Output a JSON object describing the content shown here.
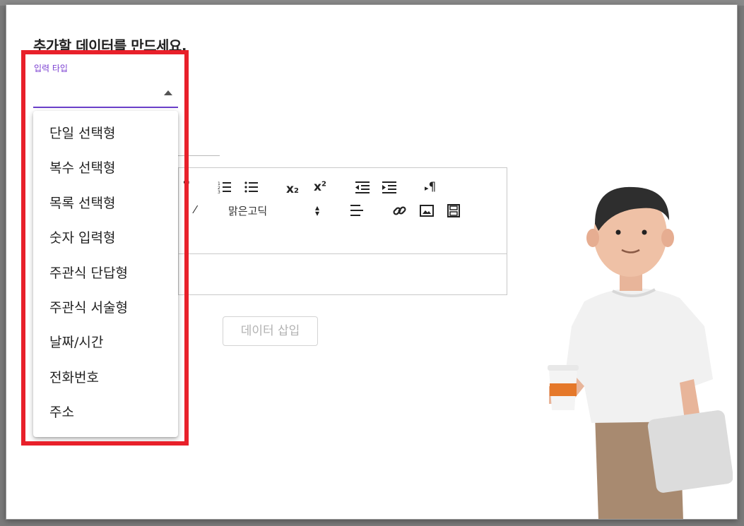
{
  "dialog": {
    "title": "추가할 데이터를 만드세요."
  },
  "input_type": {
    "label": "입력 타입",
    "options": [
      "단일 선택형",
      "복수 선택형",
      "목록 선택형",
      "숫자 입력형",
      "주관식 단답형",
      "주관식 서술형",
      "날짜/시간",
      "전화번호",
      "주소"
    ]
  },
  "editor": {
    "font_name": "맑은고딕",
    "toolbar_icons": [
      "quote-icon",
      "ordered-list-icon",
      "unordered-list-icon",
      "subscript-icon",
      "superscript-icon",
      "outdent-icon",
      "indent-icon",
      "paragraph-direction-icon",
      "clear-format-icon",
      "font-select",
      "align-icon",
      "link-icon",
      "image-icon",
      "video-icon"
    ]
  },
  "actions": {
    "insert_label": "데이터 삽입"
  },
  "colors": {
    "accent": "#7b3fd1",
    "highlight": "#e8202a"
  }
}
